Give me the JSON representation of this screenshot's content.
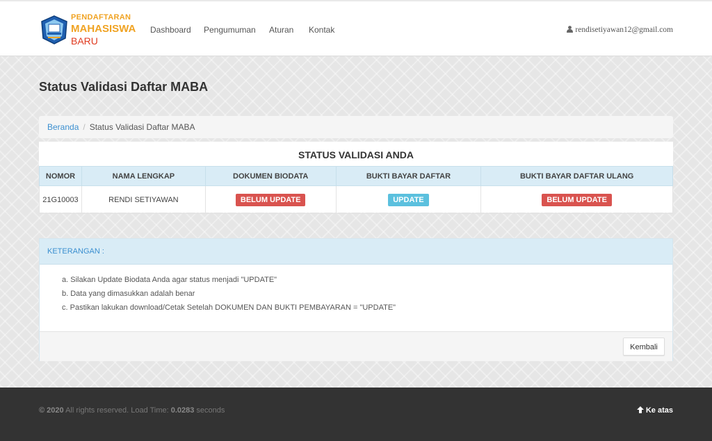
{
  "header": {
    "logo": {
      "line1": "PENDAFTARAN",
      "line2": "MAHASISWA",
      "line3": "BARU"
    },
    "nav": [
      "Dashboard",
      "Pengumuman",
      "Aturan",
      "Kontak"
    ],
    "user_email": "rendisetiyawan12@gmail.com",
    "user_icon": "user-icon"
  },
  "page_title": "Status Validasi Daftar MABA",
  "breadcrumb": {
    "home": "Beranda",
    "current": "Status Validasi Daftar MABA"
  },
  "status": {
    "title": "STATUS VALIDASI ANDA",
    "columns": [
      "NOMOR",
      "NAMA LENGKAP",
      "DOKUMEN BIODATA",
      "BUKTI BAYAR DAFTAR",
      "BUKTI BAYAR DAFTAR ULANG"
    ],
    "row": {
      "nomor": "21G10003",
      "nama": "RENDI SETIYAWAN",
      "dokumen_biodata": "BELUM UPDATE",
      "bukti_bayar_daftar": "UPDATE",
      "bukti_bayar_daftar_ulang": "BELUM UPDATE"
    }
  },
  "keterangan": {
    "title": "KETERANGAN :",
    "items": [
      "a. Silakan Update Biodata Anda agar status menjadi \"UPDATE\"",
      "b. Data yang dimasukkan adalah benar",
      "c. Pastikan lakukan download/Cetak Setelah DOKUMEN DAN BUKTI PEMBAYARAN = \"UPDATE\""
    ],
    "button": "Kembali"
  },
  "footer": {
    "year": "© 2020",
    "text1": " All rights reserved. Load Time: ",
    "load_time": "0.0283",
    "text2": " seconds",
    "to_top": "Ke atas",
    "to_top_icon": "arrow-up-icon"
  },
  "colors": {
    "label_red": "#d9534f",
    "label_blue": "#5bc0de",
    "link_blue": "#3b8fd0",
    "table_header": "#d9ecf6",
    "footer_bg": "#333333"
  }
}
